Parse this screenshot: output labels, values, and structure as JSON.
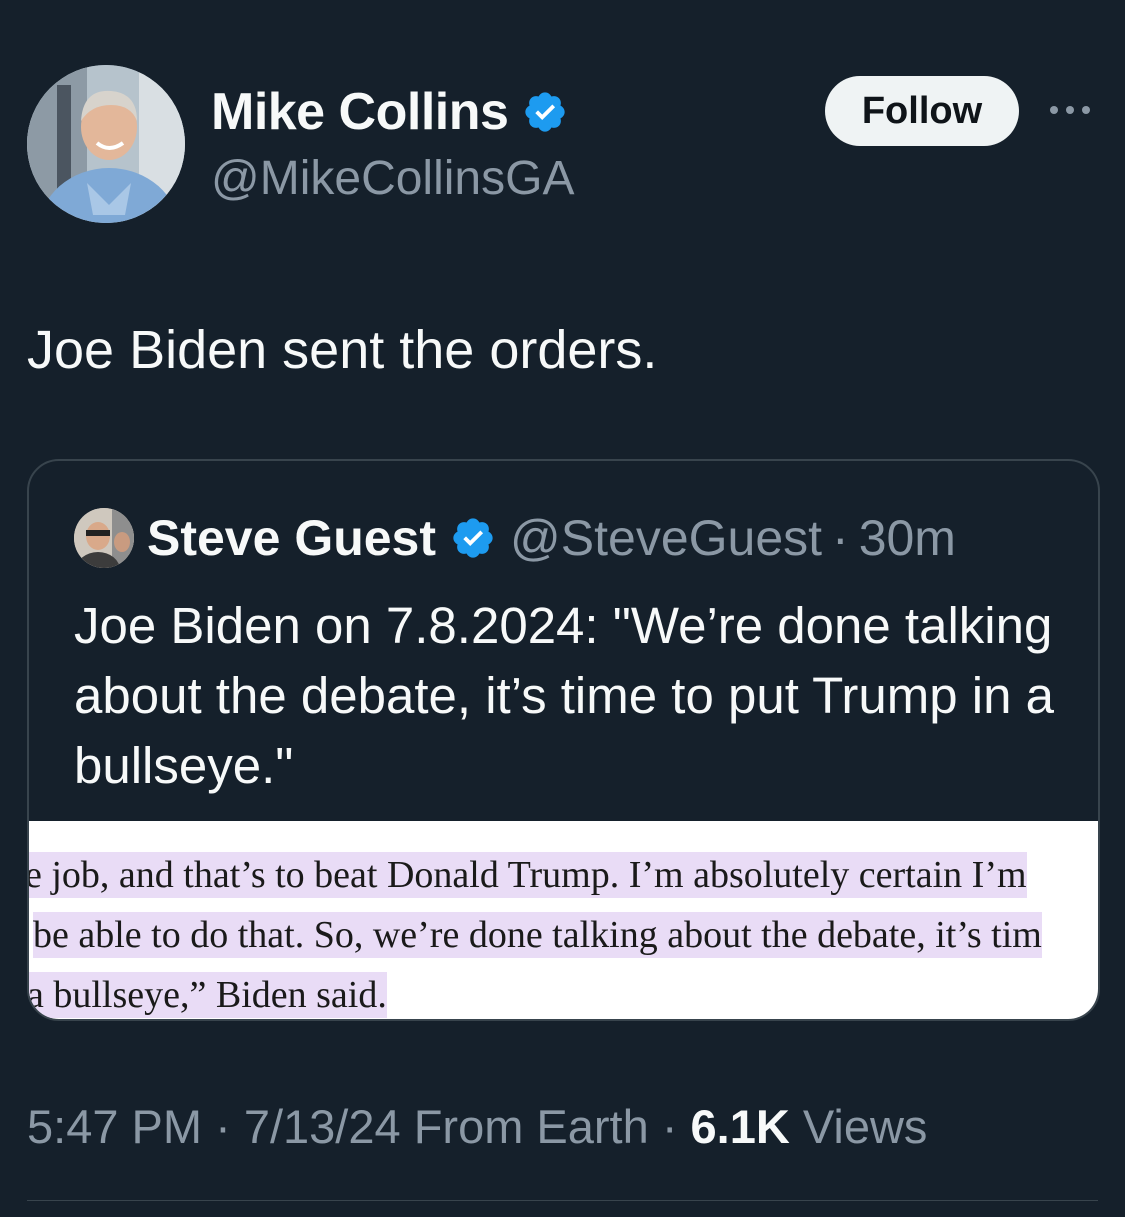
{
  "author": {
    "display_name": "Mike Collins",
    "handle": "@MikeCollinsGA",
    "verified": true
  },
  "actions": {
    "follow_label": "Follow",
    "more_icon": "more-horizontal-icon"
  },
  "tweet": {
    "text": "Joe Biden sent the orders."
  },
  "quoted_tweet": {
    "display_name": "Steve Guest",
    "handle": "@SteveGuest",
    "separator": "·",
    "time": "30m",
    "verified": true,
    "text": "Joe Biden on 7.8.2024: \"We’re done talking about the debate, it’s time to put Trump in a bullseye.\"",
    "image_lines": [
      "e job, and that’s to beat Donald Trump. I’m absolutely certain I’m",
      "be able to do that. So, we’re done talking about the debate, it’s tim",
      "a bullseye,” Biden said."
    ]
  },
  "meta": {
    "time": "5:47 PM",
    "sep1": "·",
    "date": "7/13/24",
    "source": "From Earth",
    "sep2": "·",
    "views_count": "6.1K",
    "views_label": "Views"
  },
  "colors": {
    "background": "#15202b",
    "text_primary": "#f7f9f9",
    "text_secondary": "#8b98a5",
    "verified_blue": "#1d9bf0",
    "border": "#38444d",
    "highlight": "#e9dcf6"
  }
}
